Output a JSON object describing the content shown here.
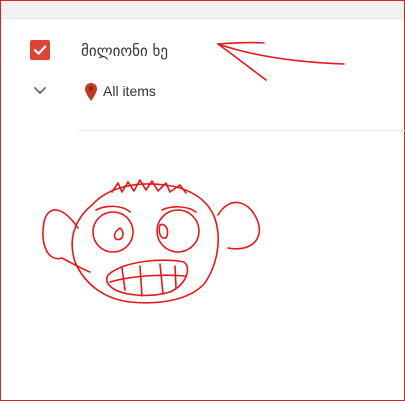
{
  "list": {
    "item": {
      "title": "მილიონი ხე",
      "checked": true,
      "checkbox_icon": "checkmark-icon",
      "expand_icon": "chevron-down-icon"
    },
    "sub_item": {
      "icon": "map-pin-icon",
      "label": "All items"
    }
  },
  "colors": {
    "accent": "#db4437",
    "annotation_red": "#e3191b",
    "text": "#333333",
    "divider": "#e8e8e8"
  }
}
